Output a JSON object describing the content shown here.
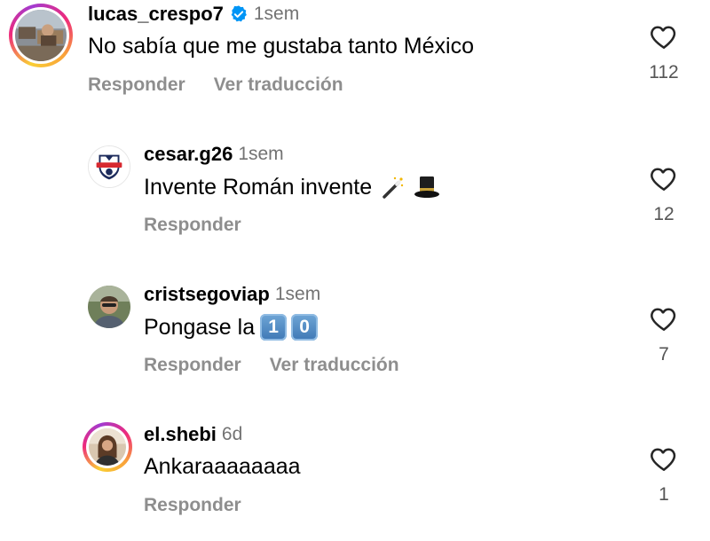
{
  "comments": [
    {
      "username": "lucas_crespo7",
      "verified": true,
      "time": "1sem",
      "text": "No sabía que me gustaba tanto México",
      "actions": [
        "Responder",
        "Ver traducción"
      ],
      "likes": "112",
      "avatar_icon": "avatar-photo-rooftop",
      "has_story_ring": true
    },
    {
      "username": "cesar.g26",
      "verified": false,
      "time": "1sem",
      "text": "Invente Román invente",
      "emojis": [
        "magic-wand-icon",
        "top-hat-icon"
      ],
      "actions": [
        "Responder"
      ],
      "likes": "12",
      "avatar_icon": "colo-colo-crest",
      "has_story_ring": false
    },
    {
      "username": "cristsegoviap",
      "verified": false,
      "time": "1sem",
      "text": "Pongase la",
      "keycaps": [
        "1",
        "0"
      ],
      "actions": [
        "Responder",
        "Ver traducción"
      ],
      "likes": "7",
      "avatar_icon": "avatar-photo-man",
      "has_story_ring": false
    },
    {
      "username": "el.shebi",
      "verified": false,
      "time": "6d",
      "text": "Ankaraaaaaaaa",
      "actions": [
        "Responder"
      ],
      "likes": "1",
      "avatar_icon": "avatar-photo-woman",
      "has_story_ring": true
    }
  ],
  "colors": {
    "verified_blue": "#0095f6",
    "meta_gray": "#737373",
    "action_gray": "#8e8e8e"
  }
}
